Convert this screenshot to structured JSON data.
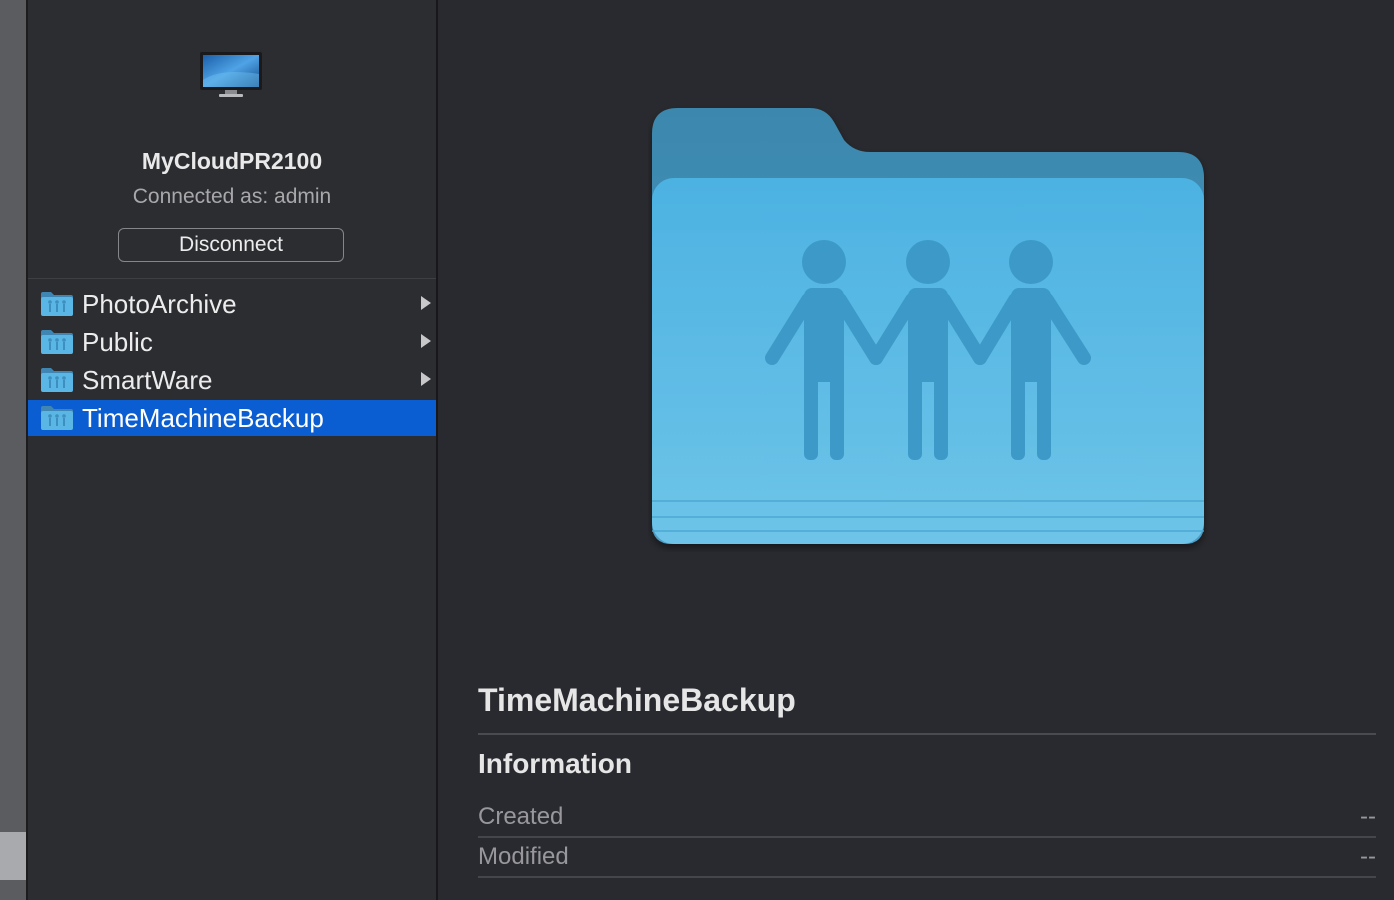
{
  "device": {
    "name": "MyCloudPR2100",
    "connected_as": "Connected as: admin",
    "disconnect_label": "Disconnect",
    "icon": "monitor-icon"
  },
  "shares": [
    {
      "label": "PhotoArchive",
      "icon": "shared-folder-icon",
      "has_chevron": true,
      "selected": false
    },
    {
      "label": "Public",
      "icon": "shared-folder-icon",
      "has_chevron": true,
      "selected": false
    },
    {
      "label": "SmartWare",
      "icon": "shared-folder-icon",
      "has_chevron": true,
      "selected": false
    },
    {
      "label": "TimeMachineBackup",
      "icon": "shared-folder-icon",
      "has_chevron": false,
      "selected": true
    }
  ],
  "preview": {
    "title": "TimeMachineBackup",
    "icon": "large-shared-folder-icon",
    "section_heading": "Information",
    "info": [
      {
        "key": "Created",
        "value": "--"
      },
      {
        "key": "Modified",
        "value": "--"
      }
    ]
  },
  "colors": {
    "selection": "#0b5ed1",
    "folder_blue": "#55b4e0",
    "background": "#292a2f"
  }
}
